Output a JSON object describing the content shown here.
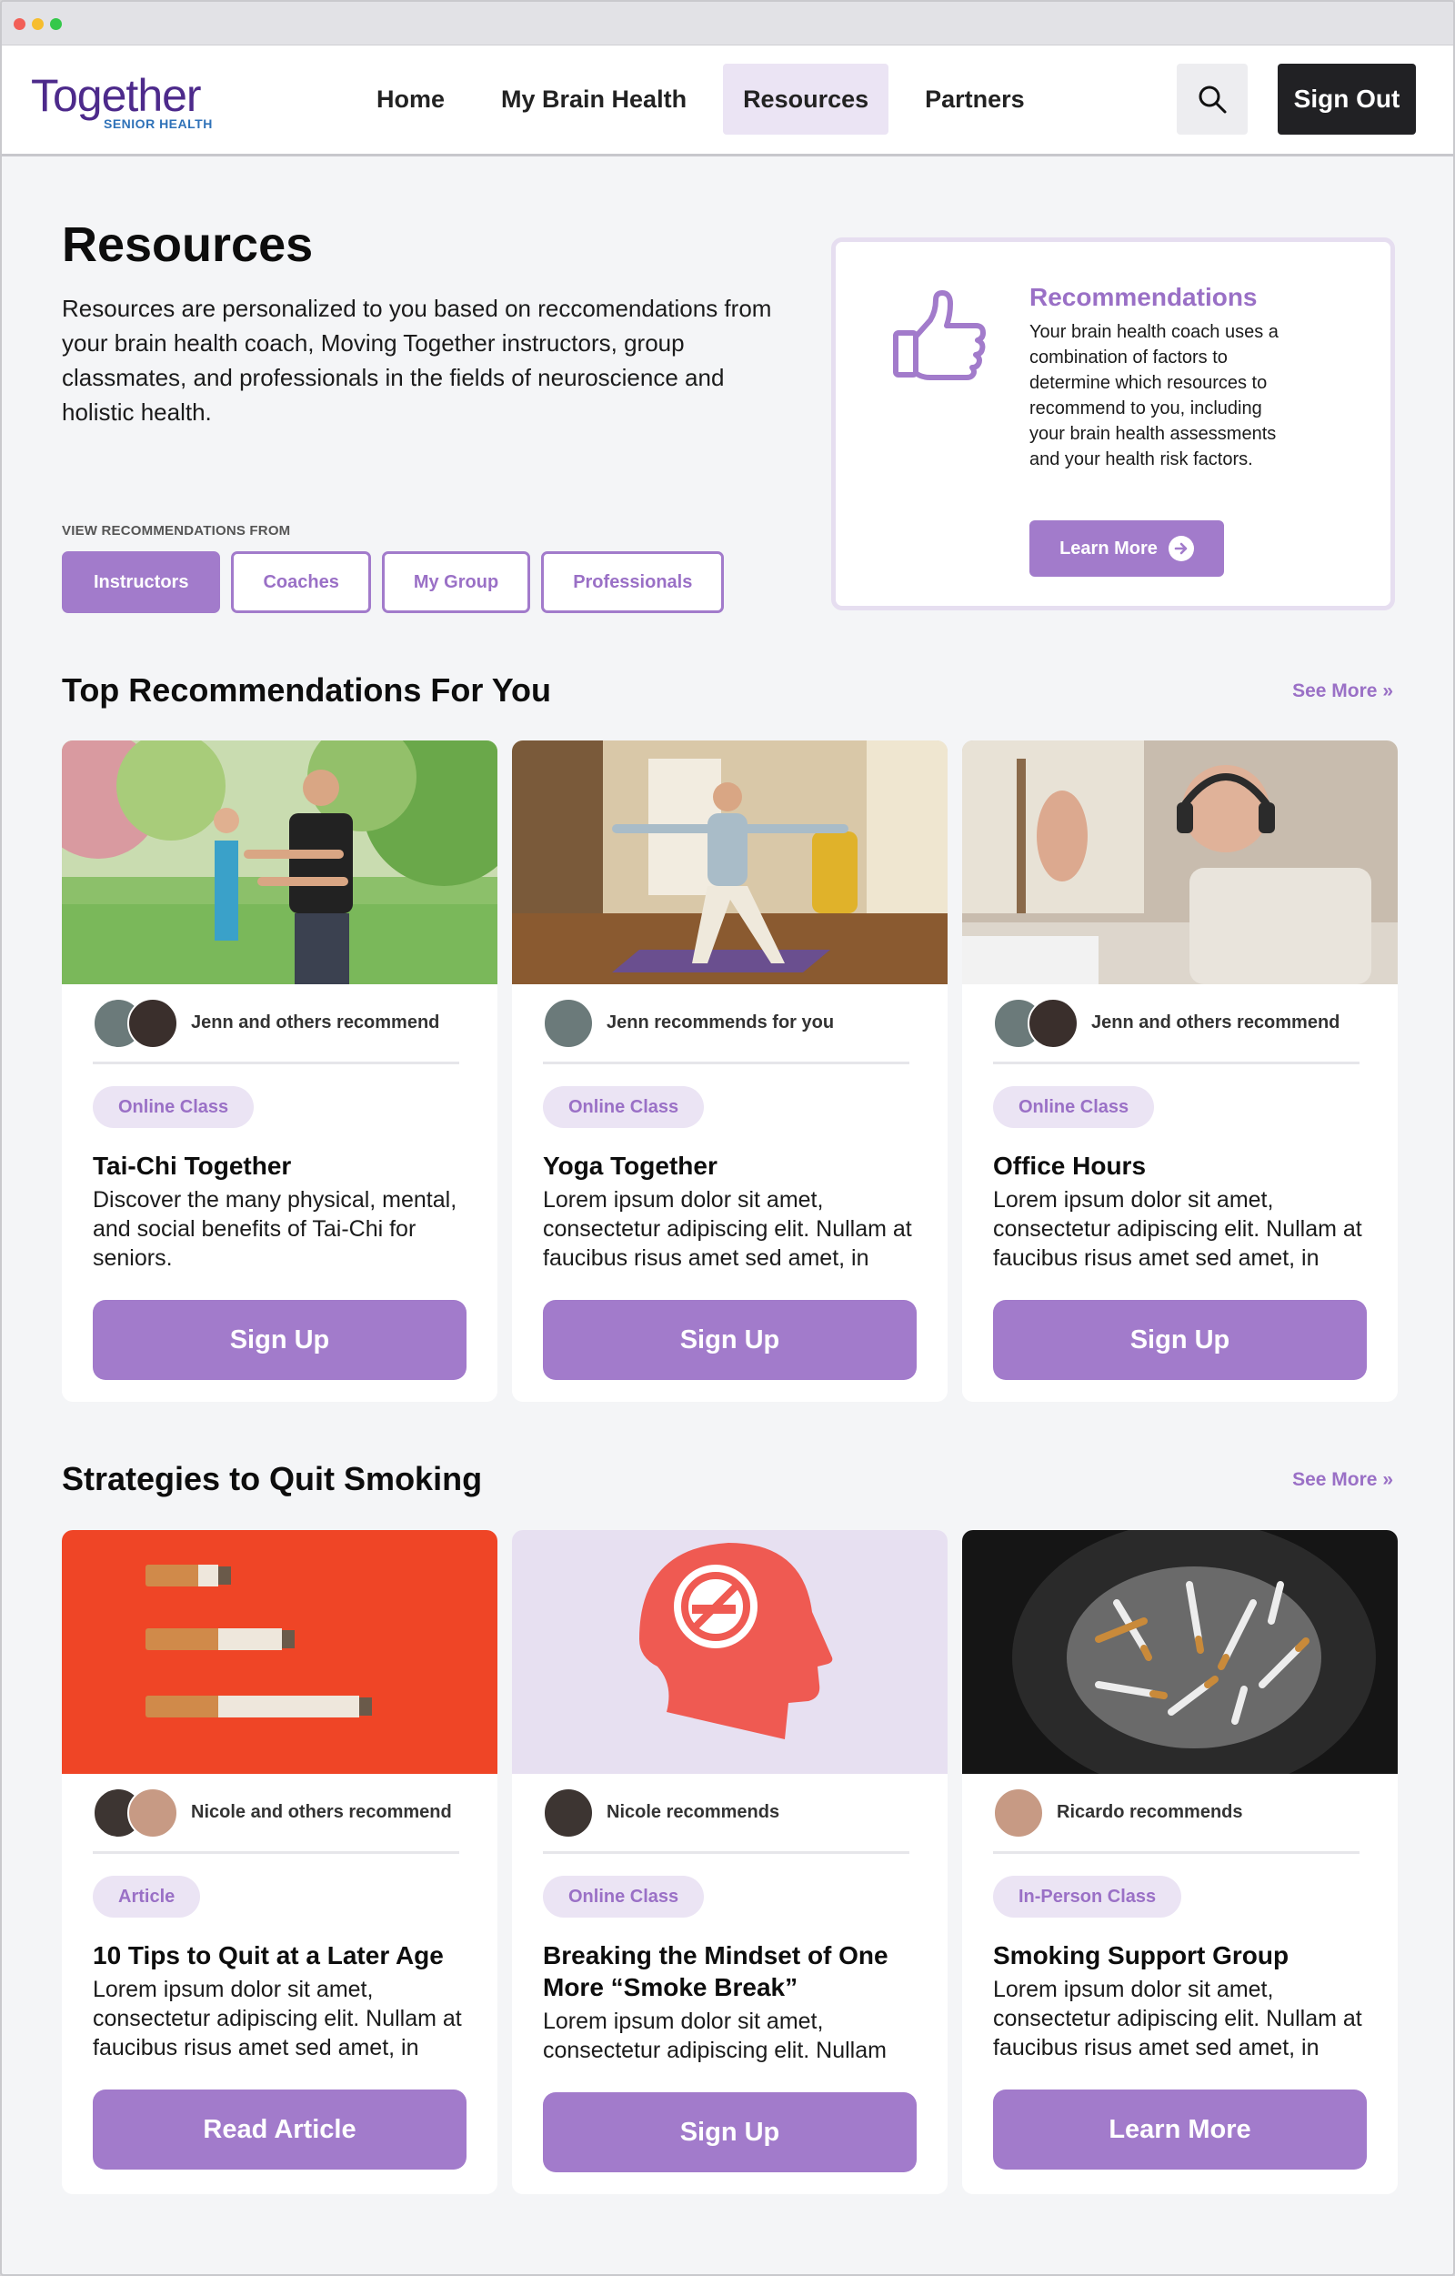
{
  "nav": {
    "logo_main": "Together",
    "logo_sub": "SENIOR HEALTH",
    "items": [
      {
        "label": "Home"
      },
      {
        "label": "My Brain Health"
      },
      {
        "label": "Resources"
      },
      {
        "label": "Partners"
      }
    ],
    "active_item": "Resources",
    "search_icon": "search-icon",
    "signout_label": "Sign Out"
  },
  "intro": {
    "title": "Resources",
    "text": "Resources are personalized to you based on reccomendations from your brain health coach, Moving Together instructors, group classmates, and professionals in the fields of neuroscience and holistic health.",
    "filter_label": "VIEW RECOMMENDATIONS FROM",
    "filters": [
      "Instructors",
      "Coaches",
      "My Group",
      "Professionals"
    ],
    "active_filter": "Instructors"
  },
  "recommendations_card": {
    "icon": "thumbs-up-icon",
    "title": "Recommendations",
    "text": "Your brain health coach uses a combination of factors to determine which resources to recommend to you, including your brain health assessments and your health risk factors.",
    "button_label": "Learn More"
  },
  "sections": [
    {
      "title": "Top Recommendations For You",
      "see_more": "See More »",
      "cards": [
        {
          "image": "tai-chi-photo",
          "recommender": "Jenn and others recommend",
          "tag": "Online Class",
          "title": "Tai-Chi Together",
          "description": "Discover the many physical, mental, and social benefits of Tai-Chi for seniors.",
          "button": "Sign Up"
        },
        {
          "image": "yoga-photo",
          "recommender": "Jenn recommends for you",
          "tag": "Online Class",
          "title": "Yoga Together",
          "description": "Lorem ipsum dolor sit amet, consectetur adipiscing elit. Nullam at faucibus risus amet sed amet, in",
          "button": "Sign Up"
        },
        {
          "image": "headphones-photo",
          "recommender": "Jenn and others recommend",
          "tag": "Online Class",
          "title": "Office Hours",
          "description": "Lorem ipsum dolor sit amet, consectetur adipiscing elit. Nullam at faucibus risus amet sed amet, in",
          "button": "Sign Up"
        }
      ]
    },
    {
      "title": "Strategies to Quit Smoking",
      "see_more": "See More »",
      "cards": [
        {
          "image": "cigarettes-photo",
          "recommender": "Nicole and others recommend",
          "tag": "Article",
          "title": "10 Tips to Quit at a Later Age",
          "description": "Lorem ipsum dolor sit amet, consectetur adipiscing elit. Nullam at faucibus risus amet sed amet, in",
          "button": "Read Article"
        },
        {
          "image": "no-smoking-head-illustration",
          "recommender": "Nicole recommends",
          "tag": "Online Class",
          "title": "Breaking the Mindset of One More “Smoke Break”",
          "description": "Lorem ipsum dolor sit amet, consectetur adipiscing elit. Nullam",
          "button": "Sign Up"
        },
        {
          "image": "ashtray-photo",
          "recommender": "Ricardo recommends",
          "tag": "In-Person Class",
          "title": "Smoking Support Group",
          "description": "Lorem ipsum dolor sit amet, consectetur adipiscing elit. Nullam at faucibus risus amet sed amet, in",
          "button": "Learn More"
        }
      ]
    }
  ],
  "colors": {
    "accent": "#a27bcb",
    "accent_light": "#ebe4f4",
    "dark_button": "#212124",
    "brand": "#4d2a8b"
  }
}
